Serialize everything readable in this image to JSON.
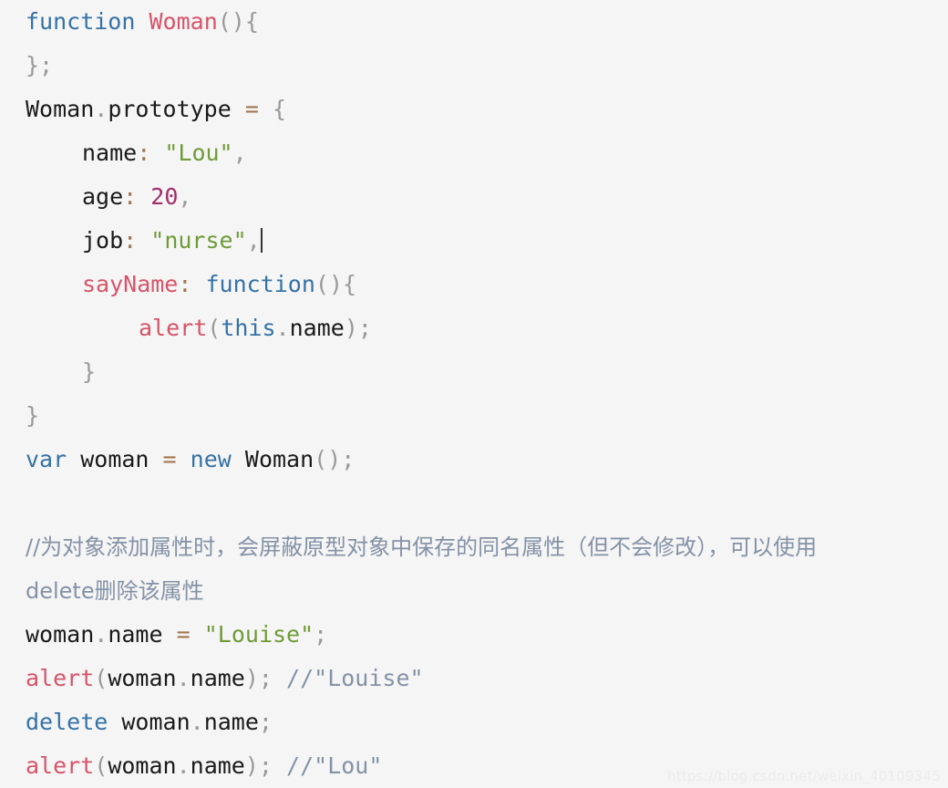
{
  "editor": {
    "background": "#f5f5f5",
    "language": "javascript",
    "font_size_px": 25,
    "line_height_px": 48,
    "caret_line_index": 5,
    "colors": {
      "keyword": "#3572a5",
      "function_name": "#d6546a",
      "string": "#6e9b38",
      "number": "#a12d6b",
      "operator": "#a1774e",
      "punctuation": "#999999",
      "identifier": "#1a1a1a",
      "comment": "#8492a6",
      "background": "#f5f5f5",
      "watermark": "#ebebeb"
    }
  },
  "lines": [
    {
      "index": 0,
      "indent": 0,
      "text": "function Woman(){",
      "tokens": [
        {
          "kind": "keyword",
          "text": "function"
        },
        {
          "kind": "space",
          "text": " "
        },
        {
          "kind": "function_name",
          "text": "Woman"
        },
        {
          "kind": "punctuation",
          "text": "(){"
        }
      ]
    },
    {
      "index": 1,
      "indent": 0,
      "text": "};",
      "tokens": [
        {
          "kind": "punctuation",
          "text": "};"
        }
      ]
    },
    {
      "index": 2,
      "indent": 0,
      "text": "Woman.prototype = {",
      "tokens": [
        {
          "kind": "identifier",
          "text": "Woman"
        },
        {
          "kind": "punctuation",
          "text": "."
        },
        {
          "kind": "identifier",
          "text": "prototype"
        },
        {
          "kind": "space",
          "text": " "
        },
        {
          "kind": "operator",
          "text": "="
        },
        {
          "kind": "space",
          "text": " "
        },
        {
          "kind": "punctuation",
          "text": "{"
        }
      ]
    },
    {
      "index": 3,
      "indent": 1,
      "text": "name: \"Lou\",",
      "tokens": [
        {
          "kind": "identifier",
          "text": "name"
        },
        {
          "kind": "operator",
          "text": ":"
        },
        {
          "kind": "space",
          "text": " "
        },
        {
          "kind": "string",
          "text": "\"Lou\""
        },
        {
          "kind": "punctuation",
          "text": ","
        }
      ]
    },
    {
      "index": 4,
      "indent": 1,
      "text": "age: 20,",
      "tokens": [
        {
          "kind": "identifier",
          "text": "age"
        },
        {
          "kind": "operator",
          "text": ":"
        },
        {
          "kind": "space",
          "text": " "
        },
        {
          "kind": "number",
          "text": "20"
        },
        {
          "kind": "punctuation",
          "text": ","
        }
      ]
    },
    {
      "index": 5,
      "indent": 1,
      "text": "job: \"nurse\",",
      "has_caret": true,
      "tokens": [
        {
          "kind": "identifier",
          "text": "job"
        },
        {
          "kind": "operator",
          "text": ":"
        },
        {
          "kind": "space",
          "text": " "
        },
        {
          "kind": "string",
          "text": "\"nurse\""
        },
        {
          "kind": "punctuation",
          "text": ","
        }
      ]
    },
    {
      "index": 6,
      "indent": 1,
      "text": "sayName: function(){",
      "tokens": [
        {
          "kind": "function_name",
          "text": "sayName"
        },
        {
          "kind": "operator",
          "text": ":"
        },
        {
          "kind": "space",
          "text": " "
        },
        {
          "kind": "keyword",
          "text": "function"
        },
        {
          "kind": "punctuation",
          "text": "(){"
        }
      ]
    },
    {
      "index": 7,
      "indent": 2,
      "text": "alert(this.name);",
      "tokens": [
        {
          "kind": "function_name",
          "text": "alert"
        },
        {
          "kind": "punctuation",
          "text": "("
        },
        {
          "kind": "keyword",
          "text": "this"
        },
        {
          "kind": "punctuation",
          "text": "."
        },
        {
          "kind": "identifier",
          "text": "name"
        },
        {
          "kind": "punctuation",
          "text": ");"
        }
      ]
    },
    {
      "index": 8,
      "indent": 1,
      "text": "}",
      "tokens": [
        {
          "kind": "punctuation",
          "text": "}"
        }
      ]
    },
    {
      "index": 9,
      "indent": 0,
      "text": "}",
      "tokens": [
        {
          "kind": "punctuation",
          "text": "}"
        }
      ]
    },
    {
      "index": 10,
      "indent": 0,
      "text": "var woman = new Woman();",
      "tokens": [
        {
          "kind": "keyword",
          "text": "var"
        },
        {
          "kind": "space",
          "text": " "
        },
        {
          "kind": "identifier",
          "text": "woman"
        },
        {
          "kind": "space",
          "text": " "
        },
        {
          "kind": "operator",
          "text": "="
        },
        {
          "kind": "space",
          "text": " "
        },
        {
          "kind": "keyword",
          "text": "new"
        },
        {
          "kind": "space",
          "text": " "
        },
        {
          "kind": "identifier",
          "text": "Woman"
        },
        {
          "kind": "punctuation",
          "text": "();"
        }
      ]
    },
    {
      "index": 11,
      "indent": 0,
      "text": "",
      "blank": true,
      "tokens": []
    },
    {
      "index": 12,
      "indent": 0,
      "cjk": true,
      "text": "//为对象添加属性时，会屏蔽原型对象中保存的同名属性（但不会修改），可以使用",
      "tokens": [
        {
          "kind": "comment",
          "text": "//为对象添加属性时，会屏蔽原型对象中保存的同名属性（但不会修改），可以使用"
        }
      ]
    },
    {
      "index": 13,
      "indent": 0,
      "cjk": true,
      "text": "delete删除该属性",
      "tokens": [
        {
          "kind": "comment",
          "text": "delete删除该属性"
        }
      ]
    },
    {
      "index": 14,
      "indent": 0,
      "text": "woman.name = \"Louise\";",
      "tokens": [
        {
          "kind": "identifier",
          "text": "woman"
        },
        {
          "kind": "punctuation",
          "text": "."
        },
        {
          "kind": "identifier",
          "text": "name"
        },
        {
          "kind": "space",
          "text": " "
        },
        {
          "kind": "operator",
          "text": "="
        },
        {
          "kind": "space",
          "text": " "
        },
        {
          "kind": "string",
          "text": "\"Louise\""
        },
        {
          "kind": "punctuation",
          "text": ";"
        }
      ]
    },
    {
      "index": 15,
      "indent": 0,
      "text": "alert(woman.name); //\"Louise\"",
      "tokens": [
        {
          "kind": "function_name",
          "text": "alert"
        },
        {
          "kind": "punctuation",
          "text": "("
        },
        {
          "kind": "identifier",
          "text": "woman"
        },
        {
          "kind": "punctuation",
          "text": "."
        },
        {
          "kind": "identifier",
          "text": "name"
        },
        {
          "kind": "punctuation",
          "text": ");"
        },
        {
          "kind": "space",
          "text": " "
        },
        {
          "kind": "comment",
          "text": "//\"Louise\""
        }
      ]
    },
    {
      "index": 16,
      "indent": 0,
      "text": "delete woman.name;",
      "tokens": [
        {
          "kind": "keyword",
          "text": "delete"
        },
        {
          "kind": "space",
          "text": " "
        },
        {
          "kind": "identifier",
          "text": "woman"
        },
        {
          "kind": "punctuation",
          "text": "."
        },
        {
          "kind": "identifier",
          "text": "name"
        },
        {
          "kind": "punctuation",
          "text": ";"
        }
      ]
    },
    {
      "index": 17,
      "indent": 0,
      "text": "alert(woman.name); //\"Lou\"",
      "tokens": [
        {
          "kind": "function_name",
          "text": "alert"
        },
        {
          "kind": "punctuation",
          "text": "("
        },
        {
          "kind": "identifier",
          "text": "woman"
        },
        {
          "kind": "punctuation",
          "text": "."
        },
        {
          "kind": "identifier",
          "text": "name"
        },
        {
          "kind": "punctuation",
          "text": ");"
        },
        {
          "kind": "space",
          "text": " "
        },
        {
          "kind": "comment",
          "text": "//\"Lou\""
        }
      ]
    }
  ],
  "watermark": {
    "text": "https://blog.csdn.net/weixin_40109345"
  }
}
